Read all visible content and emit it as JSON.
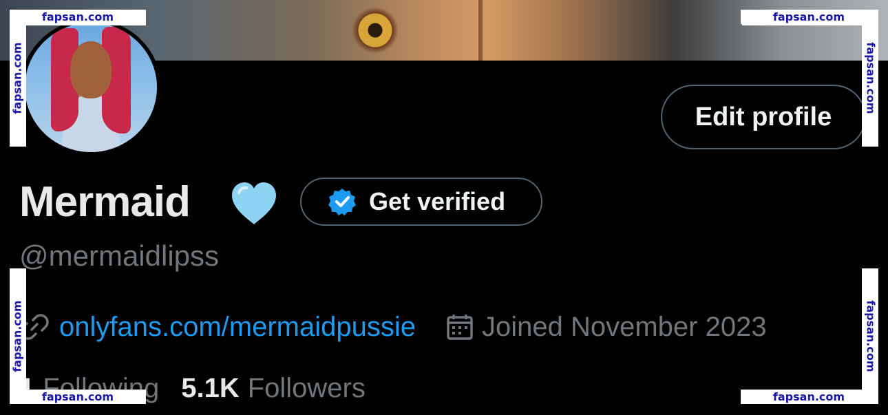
{
  "profile": {
    "display_name": "Mermaid",
    "name_emoji": "light-blue-heart",
    "handle": "@mermaidlipss",
    "edit_profile_label": "Edit profile",
    "get_verified_label": "Get verified",
    "website": "onlyfans.com/mermaidpussie",
    "joined": "Joined November 2023",
    "following_count": "1",
    "following_label": "Following",
    "followers_count": "5.1K",
    "followers_label": "Followers"
  },
  "icons": {
    "verified": "verified-badge-icon",
    "link": "link-icon",
    "calendar": "calendar-icon",
    "heart": "heart-emoji-icon"
  },
  "watermark": {
    "text": "fapsan.com"
  },
  "colors": {
    "background": "#000000",
    "text_primary": "#e7e9ea",
    "text_secondary": "#71767b",
    "link": "#1d9bf0",
    "border": "#536471",
    "heart": "#8fd3f4",
    "watermark_text": "#1a1aa8"
  }
}
